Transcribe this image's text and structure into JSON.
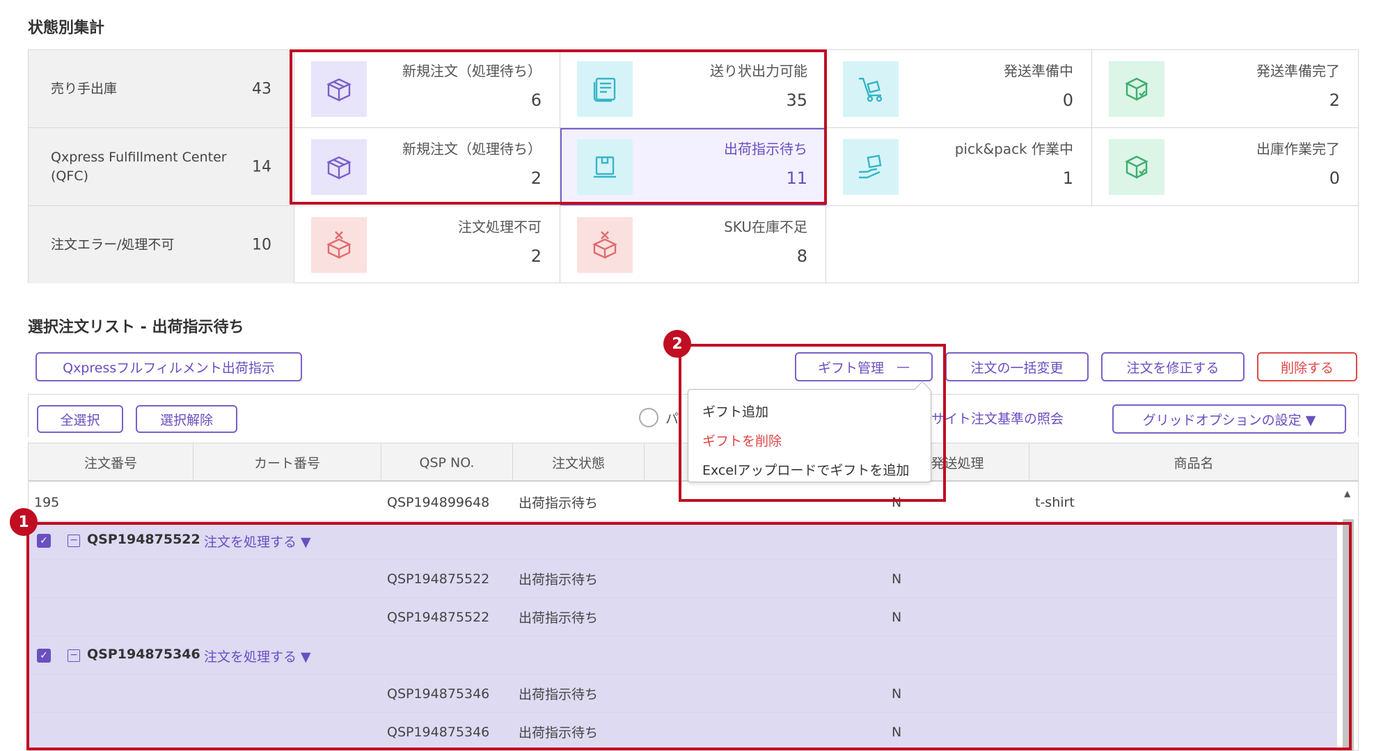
{
  "summary": {
    "title": "状態別集計",
    "rows": [
      {
        "label": "売り手出庫",
        "count": "43",
        "cells": [
          {
            "label": "新規注文（処理待ち）",
            "value": "6",
            "icon": "box-icon",
            "color": "purple"
          },
          {
            "label": "送り状出力可能",
            "value": "35",
            "icon": "invoice-icon",
            "color": "cyan"
          },
          {
            "label": "発送準備中",
            "value": "0",
            "icon": "cart-icon",
            "color": "cyan"
          },
          {
            "label": "発送準備完了",
            "value": "2",
            "icon": "box-check-icon",
            "color": "green"
          }
        ]
      },
      {
        "label": "Qxpress Fulfillment Center (QFC)",
        "count": "14",
        "cells": [
          {
            "label": "新規注文（処理待ち）",
            "value": "2",
            "icon": "box-icon",
            "color": "purple"
          },
          {
            "label": "出荷指示待ち",
            "value": "11",
            "icon": "monitor-box-icon",
            "color": "cyan",
            "selected": true
          },
          {
            "label": "pick&pack 作業中",
            "value": "1",
            "icon": "hand-box-icon",
            "color": "cyan"
          },
          {
            "label": "出庫作業完了",
            "value": "0",
            "icon": "box-check-icon",
            "color": "green"
          }
        ]
      },
      {
        "label": "注文エラー/処理不可",
        "count": "10",
        "cells": [
          {
            "label": "注文処理不可",
            "value": "2",
            "icon": "error-box-icon",
            "color": "pink"
          },
          {
            "label": "SKU在庫不足",
            "value": "8",
            "icon": "error-box-icon",
            "color": "pink"
          }
        ]
      }
    ]
  },
  "list": {
    "title": "選択注文リスト - 出荷指示待ち",
    "qxpress_button": "Qxpressフルフィルメント出荷指示",
    "gift_button": "ギフト管理",
    "gift_toggle": "—",
    "bulk_change_button": "注文の一括変更",
    "edit_button": "注文を修正する",
    "delete_button": "削除する",
    "select_all": "全選択",
    "deselect": "選択解除",
    "radio_label_partial": "パ",
    "site_query": "サイト注文基準の照会",
    "grid_options": "グリッドオプションの設定 ▼"
  },
  "dropdown": {
    "items": [
      "ギフト追加",
      "ギフトを削除",
      "Excelアップロードでギフトを追加"
    ]
  },
  "grid": {
    "columns": [
      "注文番号",
      "カート番号",
      "QSP NO.",
      "注文状態",
      "",
      "",
      "発送処理",
      "商品名"
    ],
    "first_row": {
      "order": "195",
      "qsp": "QSP194899648",
      "status": "出荷指示待ち",
      "flag": "N",
      "product": "t-shirt"
    },
    "groups": [
      {
        "order": "QSP194875522",
        "action": "注文を処理する ▼",
        "rows": [
          {
            "qsp": "QSP194875522",
            "status": "出荷指示待ち",
            "flag": "N"
          },
          {
            "qsp": "QSP194875522",
            "status": "出荷指示待ち",
            "flag": "N"
          }
        ]
      },
      {
        "order": "QSP194875346",
        "action": "注文を処理する ▼",
        "rows": [
          {
            "qsp": "QSP194875346",
            "status": "出荷指示待ち",
            "flag": "N"
          },
          {
            "qsp": "QSP194875346",
            "status": "出荷指示待ち",
            "flag": "N"
          }
        ]
      }
    ]
  },
  "badges": [
    "1",
    "2"
  ],
  "colors": {
    "accent": "#6a4fc0",
    "highlight": "#c00d22",
    "danger": "#e04646"
  }
}
